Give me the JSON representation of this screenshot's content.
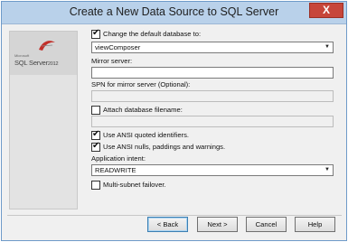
{
  "window": {
    "title": "Create a New Data Source to SQL Server",
    "close_glyph": "X"
  },
  "logo": {
    "microsoft": "Microsoft",
    "product": "SQL Server",
    "version": "2012"
  },
  "form": {
    "change_db": {
      "label": "Change the default database to:",
      "checked": true,
      "value": "viewComposer"
    },
    "mirror": {
      "label": "Mirror server:",
      "value": ""
    },
    "spn": {
      "label": "SPN for mirror server (Optional):",
      "value": ""
    },
    "attach": {
      "label": "Attach database filename:",
      "checked": false,
      "value": ""
    },
    "ansi_quoted": {
      "label": "Use ANSI quoted identifiers.",
      "checked": true
    },
    "ansi_nulls": {
      "label": "Use ANSI nulls, paddings and warnings.",
      "checked": true
    },
    "intent": {
      "label": "Application intent:",
      "value": "READWRITE"
    },
    "multisubnet": {
      "label": "Multi-subnet failover.",
      "checked": false
    }
  },
  "buttons": {
    "back": "< Back",
    "next": "Next >",
    "cancel": "Cancel",
    "help": "Help"
  }
}
